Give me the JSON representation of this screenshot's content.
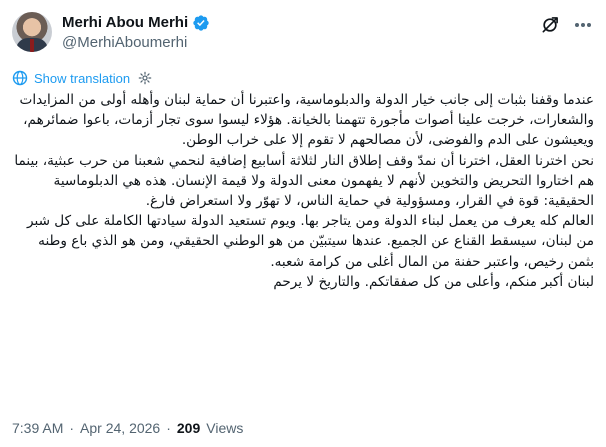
{
  "author": {
    "display_name": "Merhi Abou Merhi",
    "handle": "@MerhiAboumerhi",
    "verified": true
  },
  "header_icons": [
    "grok-icon",
    "more-icon"
  ],
  "translate": {
    "label": "Show translation"
  },
  "tweet": {
    "paragraphs": [
      "عندما وقفنا بثبات إلى جانب خيار الدولة والدبلوماسية، واعتبرنا أن حماية لبنان وأهله أولى من المزايدات والشعارات، خرجت علينا أصوات مأجورة تتهمنا بالخيانة. هؤلاء ليسوا سوى تجار أزمات، باعوا ضمائرهم، ويعيشون على الدم والفوضى، لأن مصالحهم لا تقوم إلا على خراب الوطن.",
      "نحن اخترنا العقل، اخترنا أن نمدّ وقف إطلاق النار لثلاثة أسابيع إضافية لنحمي شعبنا من حرب عبثية، بينما هم اختاروا التحريض والتخوين لأنهم لا يفهمون معنى الدولة ولا قيمة الإنسان. هذه هي الدبلوماسية الحقيقية: قوة في القرار، ومسؤولية في حماية الناس، لا تهوّر ولا استعراض فارغ.",
      "العالم كله يعرف من يعمل لبناء الدولة ومن يتاجر بها. ويوم تستعيد الدولة سيادتها الكاملة على كل شبر من لبنان، سيسقط القناع عن الجميع. عندها سيتبيّن من هو الوطني الحقيقي، ومن هو الذي باع وطنه بثمن رخيص، واعتبر حفنة من المال أغلى من كرامة شعبه.",
      "لبنان أكبر منكم، وأعلى من كل صفقاتكم. والتاريخ لا يرحم"
    ]
  },
  "meta": {
    "time": "7:39 AM",
    "separator": "·",
    "date": "Apr 24, 2026",
    "views_count": "209",
    "views_label": "Views"
  },
  "colors": {
    "text": "#0f1419",
    "secondary": "#536471",
    "accent": "#1d9bf0"
  }
}
